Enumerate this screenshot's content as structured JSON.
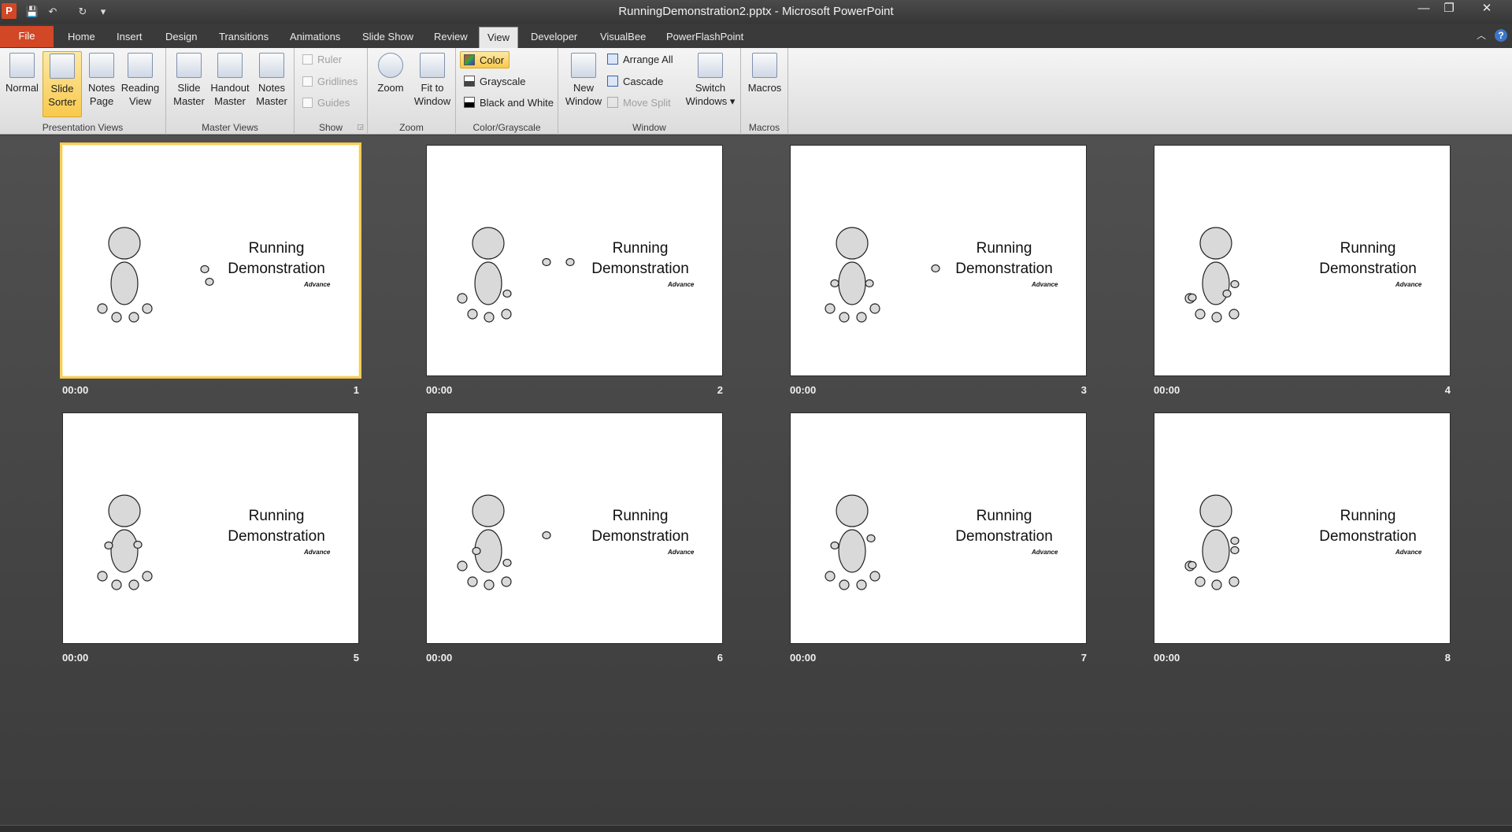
{
  "window": {
    "title": "RunningDemonstration2.pptx  -  Microsoft PowerPoint",
    "app_icon": "P",
    "controls": {
      "minimize": "—",
      "restore": "❐",
      "close": "✕"
    }
  },
  "quick_access": {
    "save": "💾",
    "undo": "↶",
    "redo": "↻",
    "customize": "▾"
  },
  "tabs": {
    "file": "File",
    "home": "Home",
    "insert": "Insert",
    "design": "Design",
    "transitions": "Transitions",
    "animations": "Animations",
    "slide_show": "Slide Show",
    "review": "Review",
    "view": "View",
    "developer": "Developer",
    "visualbee": "VisualBee",
    "powerflashpoint": "PowerFlashPoint"
  },
  "ribbon": {
    "presentation_views": {
      "label": "Presentation Views",
      "normal": [
        "Normal"
      ],
      "slide_sorter": [
        "Slide",
        "Sorter"
      ],
      "notes_page": [
        "Notes",
        "Page"
      ],
      "reading_view": [
        "Reading",
        "View"
      ]
    },
    "master_views": {
      "label": "Master Views",
      "slide_master": [
        "Slide",
        "Master"
      ],
      "handout_master": [
        "Handout",
        "Master"
      ],
      "notes_master": [
        "Notes",
        "Master"
      ]
    },
    "show": {
      "label": "Show",
      "ruler": "Ruler",
      "gridlines": "Gridlines",
      "guides": "Guides"
    },
    "zoom": {
      "label": "Zoom",
      "zoom": [
        "Zoom"
      ],
      "fit_to_window": [
        "Fit to",
        "Window"
      ]
    },
    "color_grayscale": {
      "label": "Color/Grayscale",
      "color": "Color",
      "grayscale": "Grayscale",
      "black_and_white": "Black and White"
    },
    "window": {
      "label": "Window",
      "new_window": [
        "New",
        "Window"
      ],
      "arrange_all": "Arrange All",
      "cascade": "Cascade",
      "move_split": "Move Split",
      "switch_windows": [
        "Switch",
        "Windows ▾"
      ]
    },
    "macros": {
      "label": "Macros",
      "macros": [
        "Macros"
      ]
    }
  },
  "slides": [
    {
      "number": "1",
      "time": "00:00",
      "title_line1": "Running",
      "title_line2": "Demonstration",
      "subtitle": "Advance",
      "selected": true
    },
    {
      "number": "2",
      "time": "00:00",
      "title_line1": "Running",
      "title_line2": "Demonstration",
      "subtitle": "Advance",
      "selected": false
    },
    {
      "number": "3",
      "time": "00:00",
      "title_line1": "Running",
      "title_line2": "Demonstration",
      "subtitle": "Advance",
      "selected": false
    },
    {
      "number": "4",
      "time": "00:00",
      "title_line1": "Running",
      "title_line2": "Demonstration",
      "subtitle": "Advance",
      "selected": false
    },
    {
      "number": "5",
      "time": "00:00",
      "title_line1": "Running",
      "title_line2": "Demonstration",
      "subtitle": "Advance",
      "selected": false
    },
    {
      "number": "6",
      "time": "00:00",
      "title_line1": "Running",
      "title_line2": "Demonstration",
      "subtitle": "Advance",
      "selected": false
    },
    {
      "number": "7",
      "time": "00:00",
      "title_line1": "Running",
      "title_line2": "Demonstration",
      "subtitle": "Advance",
      "selected": false
    },
    {
      "number": "8",
      "time": "00:00",
      "title_line1": "Running",
      "title_line2": "Demonstration",
      "subtitle": "Advance",
      "selected": false
    }
  ],
  "colors": {
    "file_tab": "#d24726",
    "selection": "#f8cc58",
    "sorter_bg": "#454545"
  }
}
